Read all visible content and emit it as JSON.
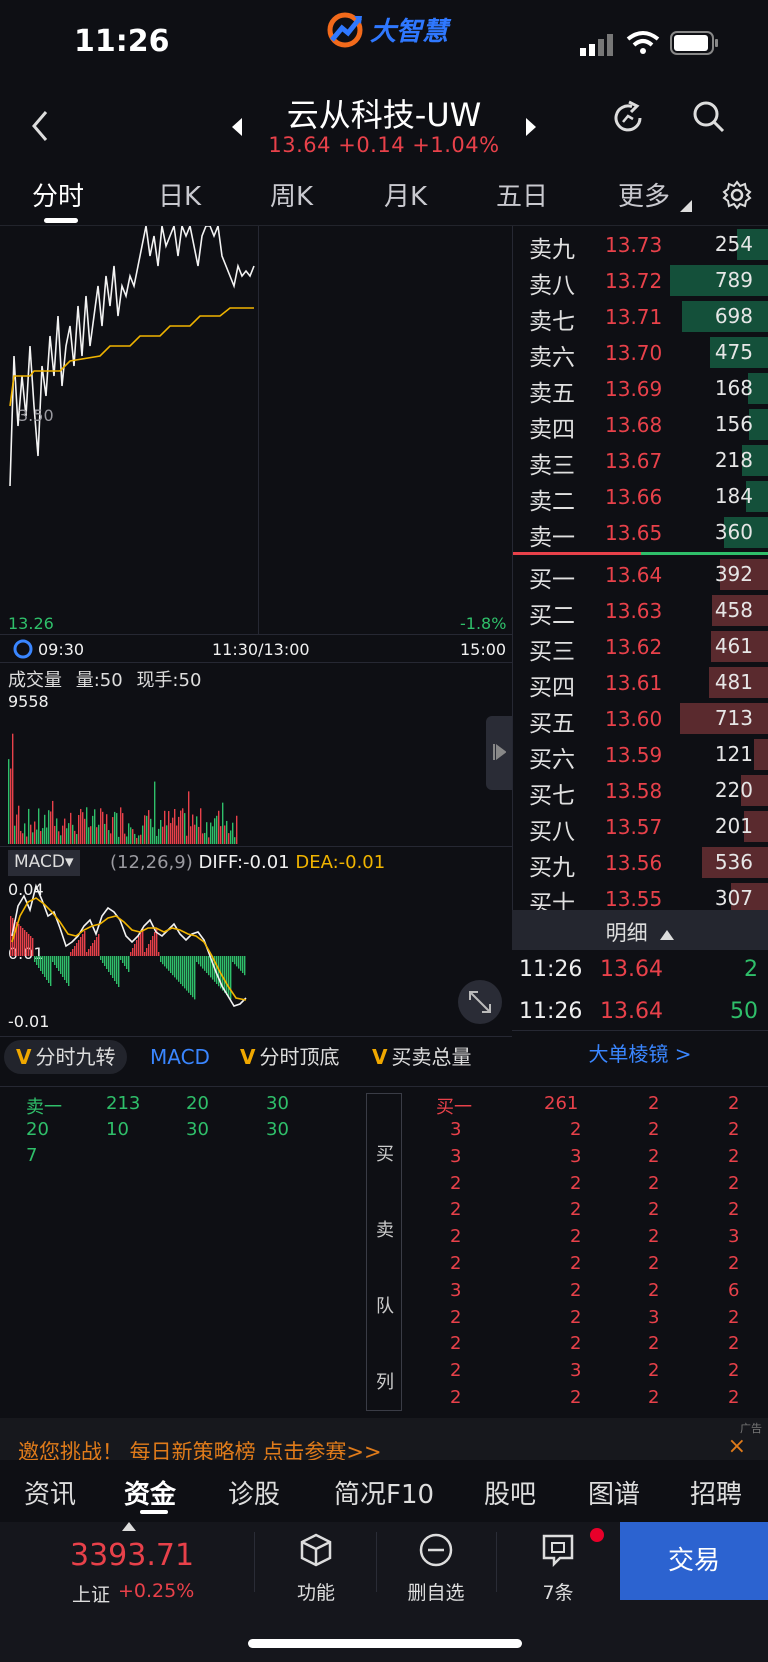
{
  "status": {
    "time": "11:26"
  },
  "app": {
    "logo_text": "大智慧"
  },
  "header": {
    "title": "云从科技-UW",
    "price": "13.64",
    "change": "+0.14",
    "change_pct": "+1.04%"
  },
  "tabs": [
    "分时",
    "日K",
    "周K",
    "月K",
    "五日",
    "更多"
  ],
  "chart": {
    "price_mid_label": "3.50",
    "low_label": "13.26",
    "low_pct": "-1.8%",
    "time_start": "09:30",
    "time_mid": "11:30/13:00",
    "time_end": "15:00",
    "volume_title": "成交量",
    "volume_value": "量:50",
    "volume_hand": "现手:50",
    "volume_max": "9558",
    "macd_label": "MACD▾",
    "macd_params": "(12,26,9)",
    "macd_diff": "DIFF:-0.01",
    "macd_dea": "DEA:-0.01",
    "macd_top": "0.04",
    "macd_mid": "0.01",
    "macd_bottom": "-0.01"
  },
  "indicators": [
    "分时九转",
    "MACD",
    "分时顶底",
    "买卖总量"
  ],
  "orderbook": {
    "asks": [
      {
        "label": "卖九",
        "price": "13.73",
        "vol": "254",
        "level": 254
      },
      {
        "label": "卖八",
        "price": "13.72",
        "vol": "789",
        "level": 789
      },
      {
        "label": "卖七",
        "price": "13.71",
        "vol": "698",
        "level": 698
      },
      {
        "label": "卖六",
        "price": "13.70",
        "vol": "475",
        "level": 475
      },
      {
        "label": "卖五",
        "price": "13.69",
        "vol": "168",
        "level": 168
      },
      {
        "label": "卖四",
        "price": "13.68",
        "vol": "156",
        "level": 156
      },
      {
        "label": "卖三",
        "price": "13.67",
        "vol": "218",
        "level": 218
      },
      {
        "label": "卖二",
        "price": "13.66",
        "vol": "184",
        "level": 184
      },
      {
        "label": "卖一",
        "price": "13.65",
        "vol": "360",
        "level": 360
      }
    ],
    "bids": [
      {
        "label": "买一",
        "price": "13.64",
        "vol": "392",
        "level": 392
      },
      {
        "label": "买二",
        "price": "13.63",
        "vol": "458",
        "level": 458
      },
      {
        "label": "买三",
        "price": "13.62",
        "vol": "461",
        "level": 461
      },
      {
        "label": "买四",
        "price": "13.61",
        "vol": "481",
        "level": 481
      },
      {
        "label": "买五",
        "price": "13.60",
        "vol": "713",
        "level": 713
      },
      {
        "label": "买六",
        "price": "13.59",
        "vol": "121",
        "level": 121
      },
      {
        "label": "买七",
        "price": "13.58",
        "vol": "220",
        "level": 220
      },
      {
        "label": "买八",
        "price": "13.57",
        "vol": "201",
        "level": 201
      },
      {
        "label": "买九",
        "price": "13.56",
        "vol": "536",
        "level": 536
      },
      {
        "label": "买十",
        "price": "13.55",
        "vol": "307",
        "level": 307
      }
    ],
    "detail_label": "明细",
    "trades": [
      {
        "time": "11:26",
        "price": "13.64",
        "vol": "2"
      },
      {
        "time": "11:26",
        "price": "13.64",
        "vol": "50"
      }
    ],
    "big_order_link": "大单棱镜 >"
  },
  "queue": {
    "ask_label": "卖一",
    "ask_rows": [
      [
        "213",
        "20",
        "30"
      ],
      [
        "20",
        "10",
        "30",
        "30"
      ],
      [
        "7"
      ]
    ],
    "side_label": [
      "买",
      "卖",
      "队",
      "列"
    ],
    "bid_label": "买一",
    "bid_first": [
      "261",
      "2",
      "2"
    ],
    "bid_rows": [
      [
        "3",
        "2",
        "2",
        "2"
      ],
      [
        "3",
        "3",
        "2",
        "2"
      ],
      [
        "2",
        "2",
        "2",
        "2"
      ],
      [
        "2",
        "2",
        "2",
        "2"
      ],
      [
        "2",
        "2",
        "2",
        "3"
      ],
      [
        "2",
        "2",
        "2",
        "2"
      ],
      [
        "3",
        "2",
        "2",
        "6"
      ],
      [
        "2",
        "2",
        "3",
        "2"
      ],
      [
        "2",
        "2",
        "2",
        "2"
      ],
      [
        "2",
        "3",
        "2",
        "2"
      ],
      [
        "2",
        "2",
        "2",
        "2"
      ]
    ]
  },
  "ad": {
    "text": "邀您挑战！ 每日新策略榜    点击参赛>>",
    "tag": "广告",
    "close": "×"
  },
  "subtabs": [
    "资讯",
    "资金",
    "诊股",
    "简况F10",
    "股吧",
    "图谱",
    "招聘"
  ],
  "bottom": {
    "index_value": "3393.71",
    "index_name": "上证",
    "index_change": "+0.25%",
    "func_label": "功能",
    "del_label": "删自选",
    "ask_label": "7条",
    "trade_label": "交易"
  },
  "colors": {
    "up": "#e8414a",
    "down": "#2fbf6a",
    "accent": "#2c63d0",
    "avg_line": "#f0b400"
  }
}
